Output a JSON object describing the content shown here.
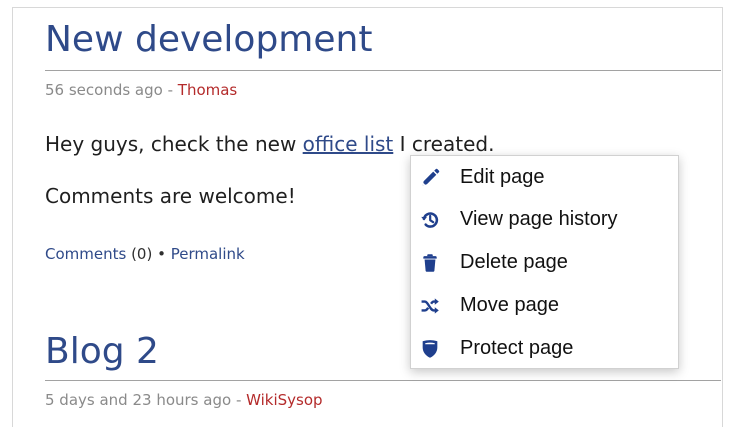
{
  "posts": [
    {
      "title": "New development",
      "timestamp": "56 seconds ago",
      "meta_separator": " - ",
      "author": "Thomas",
      "body_line1_before": "Hey guys, check the new ",
      "body_line1_link": "office list",
      "body_line1_after": " I created.",
      "body_line2": "Comments are welcome!",
      "footer": {
        "comments_label": "Comments",
        "comments_count": " (0) ",
        "separator": "•",
        "permalink_label": " Permalink"
      }
    },
    {
      "title": "Blog 2",
      "timestamp": "5 days and 23 hours ago",
      "meta_separator": " - ",
      "author": "WikiSysop"
    }
  ],
  "context_menu": {
    "items": [
      {
        "label": "Edit page",
        "icon": "pencil-icon"
      },
      {
        "label": "View page history",
        "icon": "history-icon"
      },
      {
        "label": "Delete page",
        "icon": "trash-icon"
      },
      {
        "label": "Move page",
        "icon": "shuffle-icon"
      },
      {
        "label": "Protect page",
        "icon": "shield-icon"
      }
    ]
  },
  "colors": {
    "title": "#2f4a89",
    "author": "#b42b2b",
    "link": "#2f4a89",
    "menu_icon": "#1f3f8d"
  }
}
